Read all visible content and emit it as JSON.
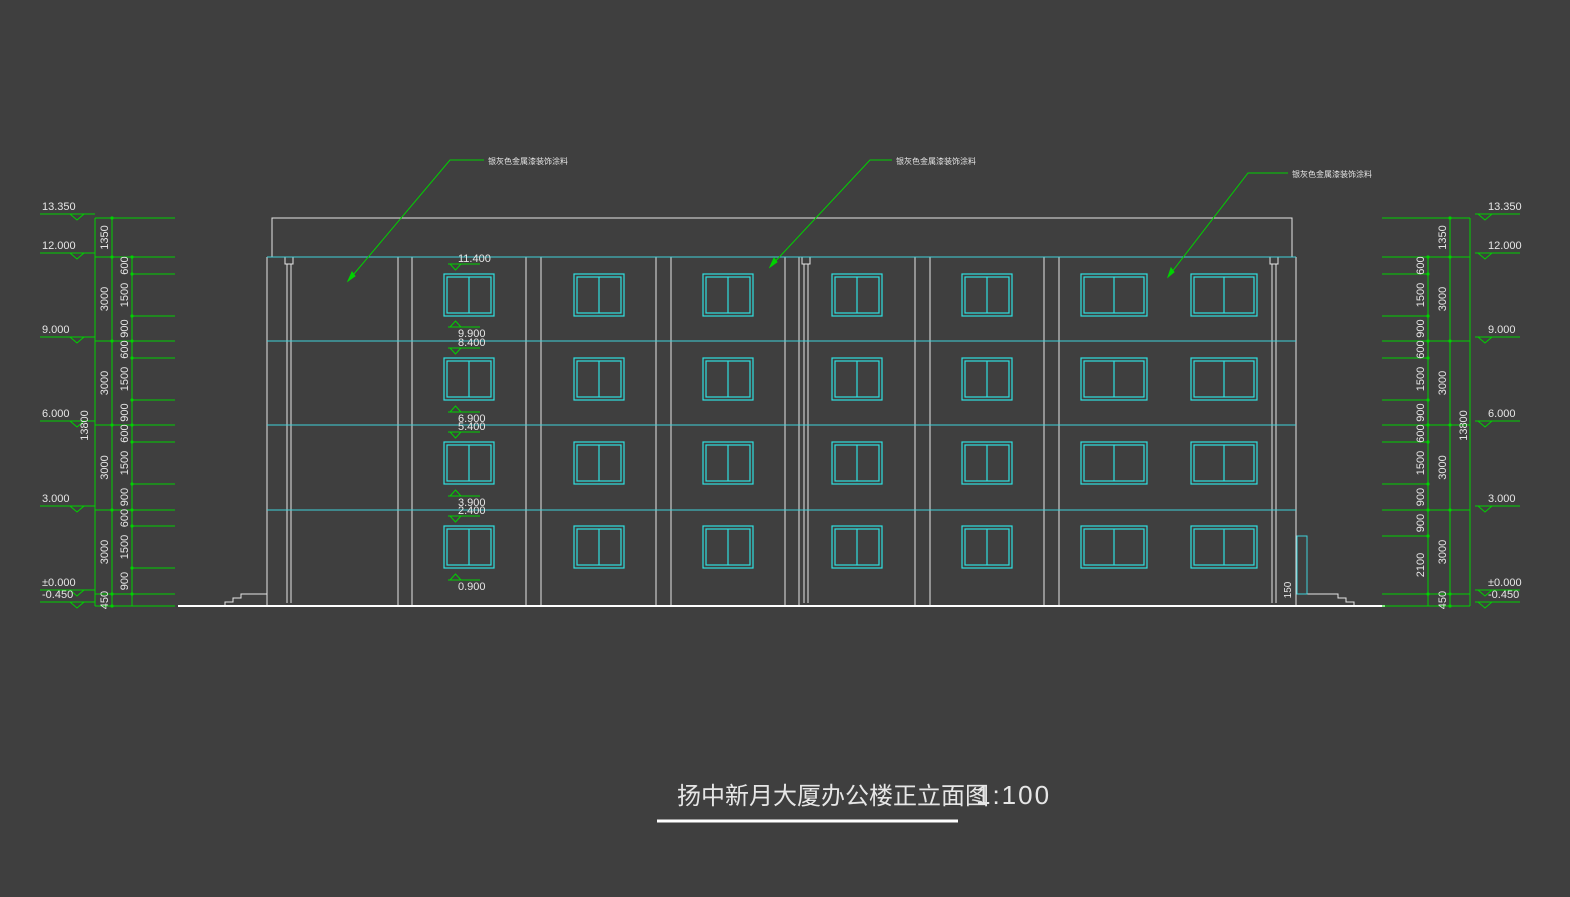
{
  "drawing": {
    "title": "扬中新月大厦办公楼正立面图",
    "scale": "1:100",
    "callouts": [
      "银灰色金属漆装饰涂料",
      "银灰色金属漆装饰涂料",
      "银灰色金属漆装饰涂料"
    ],
    "colors": {
      "background": "#3f3f3f",
      "dimension": "#00d200",
      "outline": "#e6e6e6",
      "floor_line": "#3fd0d8",
      "window": "#2fe0e0"
    }
  },
  "levels": [
    "13.350",
    "12.000",
    "9.000",
    "6.000",
    "3.000",
    "±0.000",
    "-0.450"
  ],
  "window_levels": [
    "11.400",
    "9.900",
    "8.400",
    "6.900",
    "5.400",
    "3.900",
    "2.400",
    "0.900"
  ],
  "left_dims": {
    "outer": [
      "1350",
      "3000",
      "3000",
      "3000",
      "3000",
      "450"
    ],
    "outer_label_rows": [
      "1350",
      "3000",
      "3000",
      "3000",
      "450"
    ],
    "total": "13800",
    "inner": [
      "600",
      "1500",
      "900",
      "600",
      "1500",
      "900",
      "600",
      "1500",
      "900",
      "600",
      "1500",
      "900"
    ]
  },
  "right_dims": {
    "outer": [
      "1350",
      "3000",
      "3000",
      "3000",
      "3000",
      "450"
    ],
    "total": "13800",
    "inner": [
      "600",
      "1500",
      "900",
      "600",
      "1500",
      "900",
      "600",
      "1500",
      "900",
      "900",
      "2100"
    ]
  },
  "misc_dims": [
    "150"
  ]
}
